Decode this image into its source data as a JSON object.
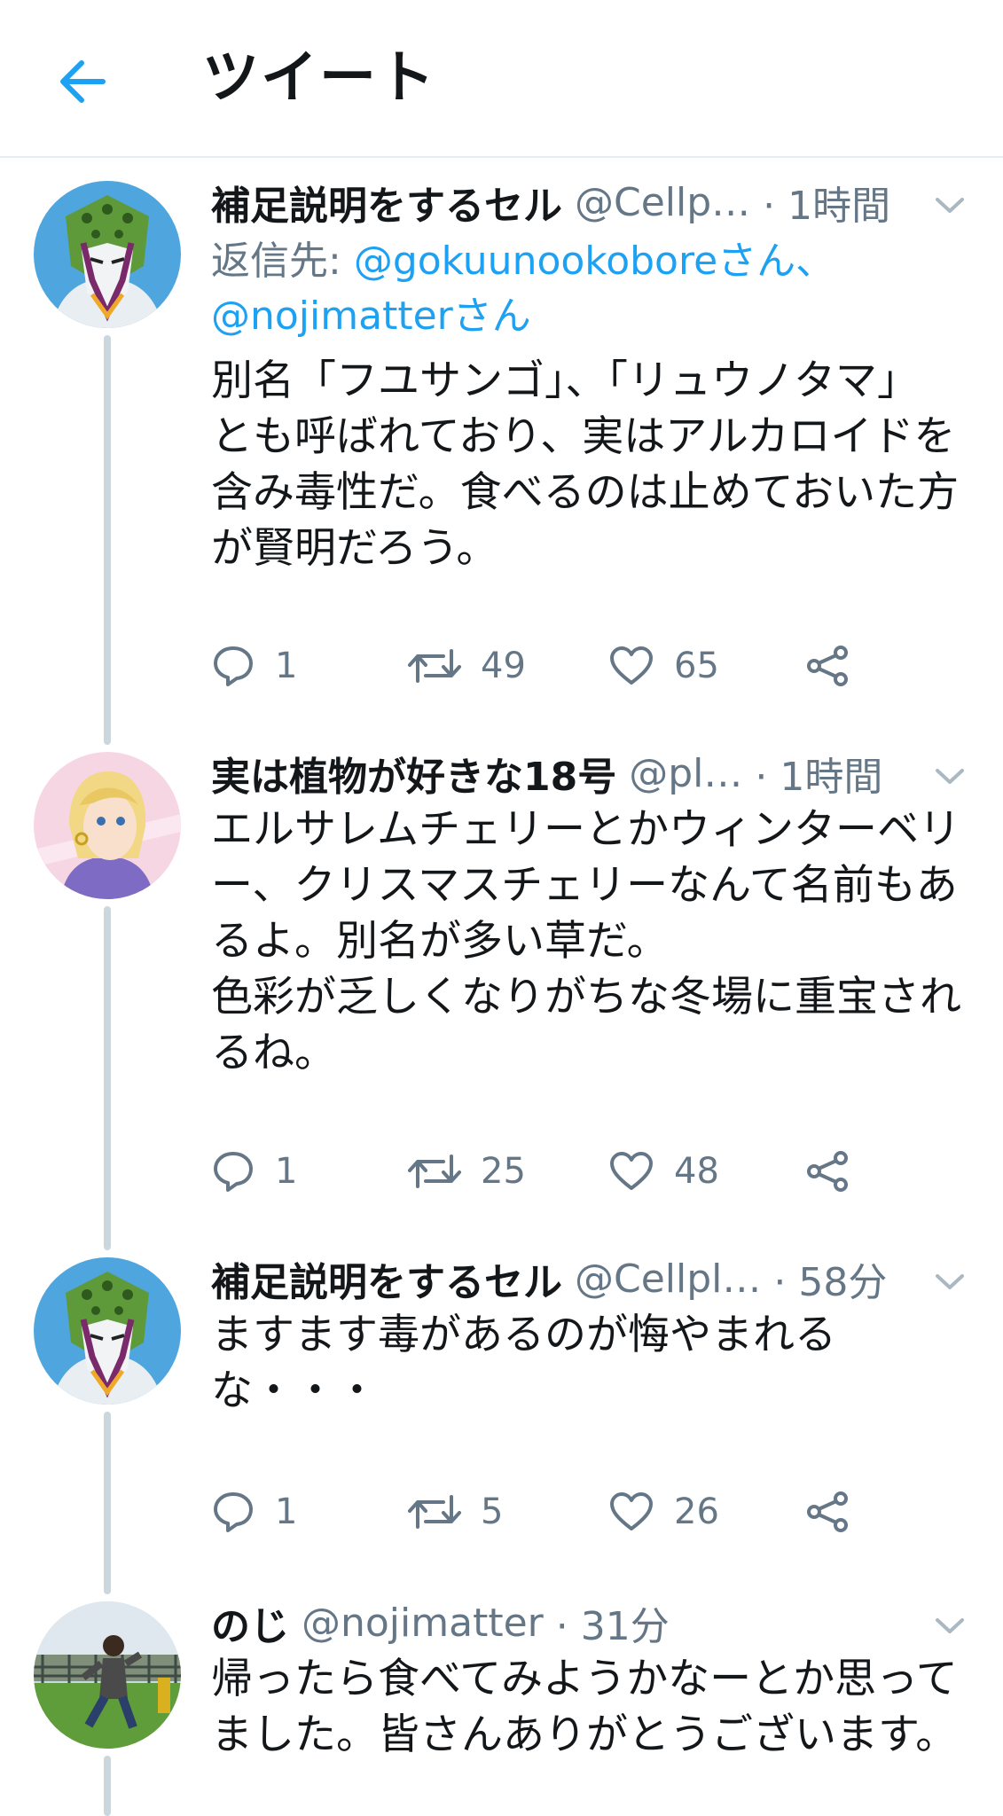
{
  "header": {
    "title": "ツイート",
    "back_icon": "arrow-left-icon",
    "accent": "#1da1f2"
  },
  "tweets": [
    {
      "name": "補足説明をするセル",
      "handle": "@Cellp…",
      "time": "· 1時間",
      "reply_label": "返信先: ",
      "reply_mention_1": "@gokuunookoboreさん、",
      "reply_mention_2": "@nojimatterさん",
      "text": "別名「フユサンゴ」、「リュウノタマ」\nとも呼ばれており、実はアルカロイドを\n含み毒性だ。食べるのは止めておいた方\nが賢明だろう。",
      "replies": "1",
      "retweets": "49",
      "likes": "65"
    },
    {
      "name": "実は植物が好きな18号",
      "handle": "@pl…",
      "time": "· 1時間",
      "text": "エルサレムチェリーとかウィンターベリ\nー、クリスマスチェリーなんて名前もあ\nるよ。別名が多い草だ。\n色彩が乏しくなりがちな冬場に重宝され\nるね。",
      "replies": "1",
      "retweets": "25",
      "likes": "48"
    },
    {
      "name": "補足説明をするセル",
      "handle": "@Cellpl…",
      "time": "· 58分",
      "text": "ますます毒があるのが悔やまれる\nな・・・",
      "replies": "1",
      "retweets": "5",
      "likes": "26"
    },
    {
      "name": "のじ",
      "handle": "@nojimatter",
      "time": "· 31分",
      "text": "帰ったら食べてみようかなーとか思って\nました。皆さんありがとうございます。"
    }
  ]
}
